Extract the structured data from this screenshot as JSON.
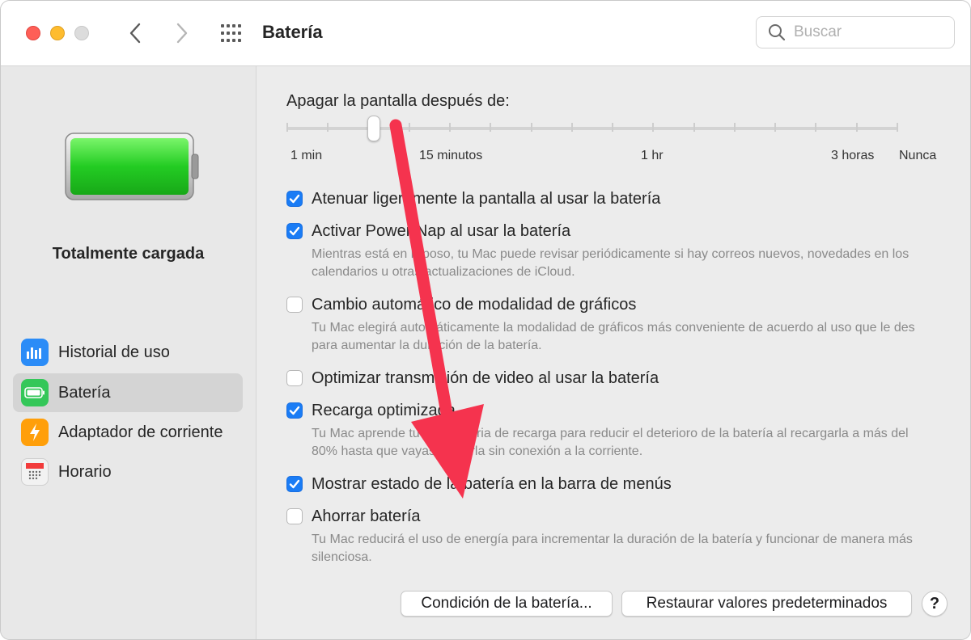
{
  "window": {
    "title": "Batería"
  },
  "toolbar": {
    "search_placeholder": "Buscar",
    "back_icon": "chevron-left-icon",
    "forward_icon": "chevron-right-icon",
    "grid_icon": "grid-icon"
  },
  "sidebar": {
    "battery_status": "Totalmente cargada",
    "items": [
      {
        "label": "Historial de uso",
        "icon": "bar-chart-icon",
        "color": "#2b8cf7"
      },
      {
        "label": "Batería",
        "icon": "battery-icon",
        "color": "#34c759",
        "active": true
      },
      {
        "label": "Adaptador de corriente",
        "icon": "bolt-icon",
        "color": "#ff9f0a"
      },
      {
        "label": "Horario",
        "icon": "calendar-icon",
        "color": "#f2f2f2"
      }
    ]
  },
  "display_sleep": {
    "title": "Apagar la pantalla después de:",
    "value_fraction": 0.14,
    "labels": [
      "1 min",
      "15 minutos",
      "1 hr",
      "3 horas",
      "Nunca"
    ]
  },
  "options": [
    {
      "label": "Atenuar ligeramente la pantalla al usar la batería",
      "checked": true,
      "description": ""
    },
    {
      "label": "Activar Power Nap al usar la batería",
      "checked": true,
      "description": "Mientras está en reposo, tu Mac puede revisar periódicamente si hay correos nuevos, novedades en los calendarios u otras actualizaciones de iCloud."
    },
    {
      "label": "Cambio automático de modalidad de gráficos",
      "checked": false,
      "description": "Tu Mac elegirá automáticamente la modalidad de gráficos más conveniente de acuerdo al uso que le des para aumentar la duración de la batería."
    },
    {
      "label": "Optimizar transmisión de video al usar la batería",
      "checked": false,
      "description": ""
    },
    {
      "label": "Recarga optimizada",
      "checked": true,
      "description": "Tu Mac aprende tu rutina diaria de recarga para reducir el deterioro de la batería al recargarla a más del 80% hasta que vayas a usarla sin conexión a la corriente."
    },
    {
      "label": "Mostrar estado de la batería en la barra de menús",
      "checked": true,
      "description": ""
    },
    {
      "label": "Ahorrar batería",
      "checked": false,
      "description": "Tu Mac reducirá el uso de energía para incrementar la duración de la batería y funcionar de manera más silenciosa."
    }
  ],
  "buttons": {
    "battery_health": "Condición de la batería...",
    "restore_defaults": "Restaurar valores predeterminados",
    "help": "?"
  },
  "colors": {
    "accent": "#1a7cf5",
    "annotation_arrow": "#f5334e",
    "battery_fill": "#2fd62f"
  }
}
